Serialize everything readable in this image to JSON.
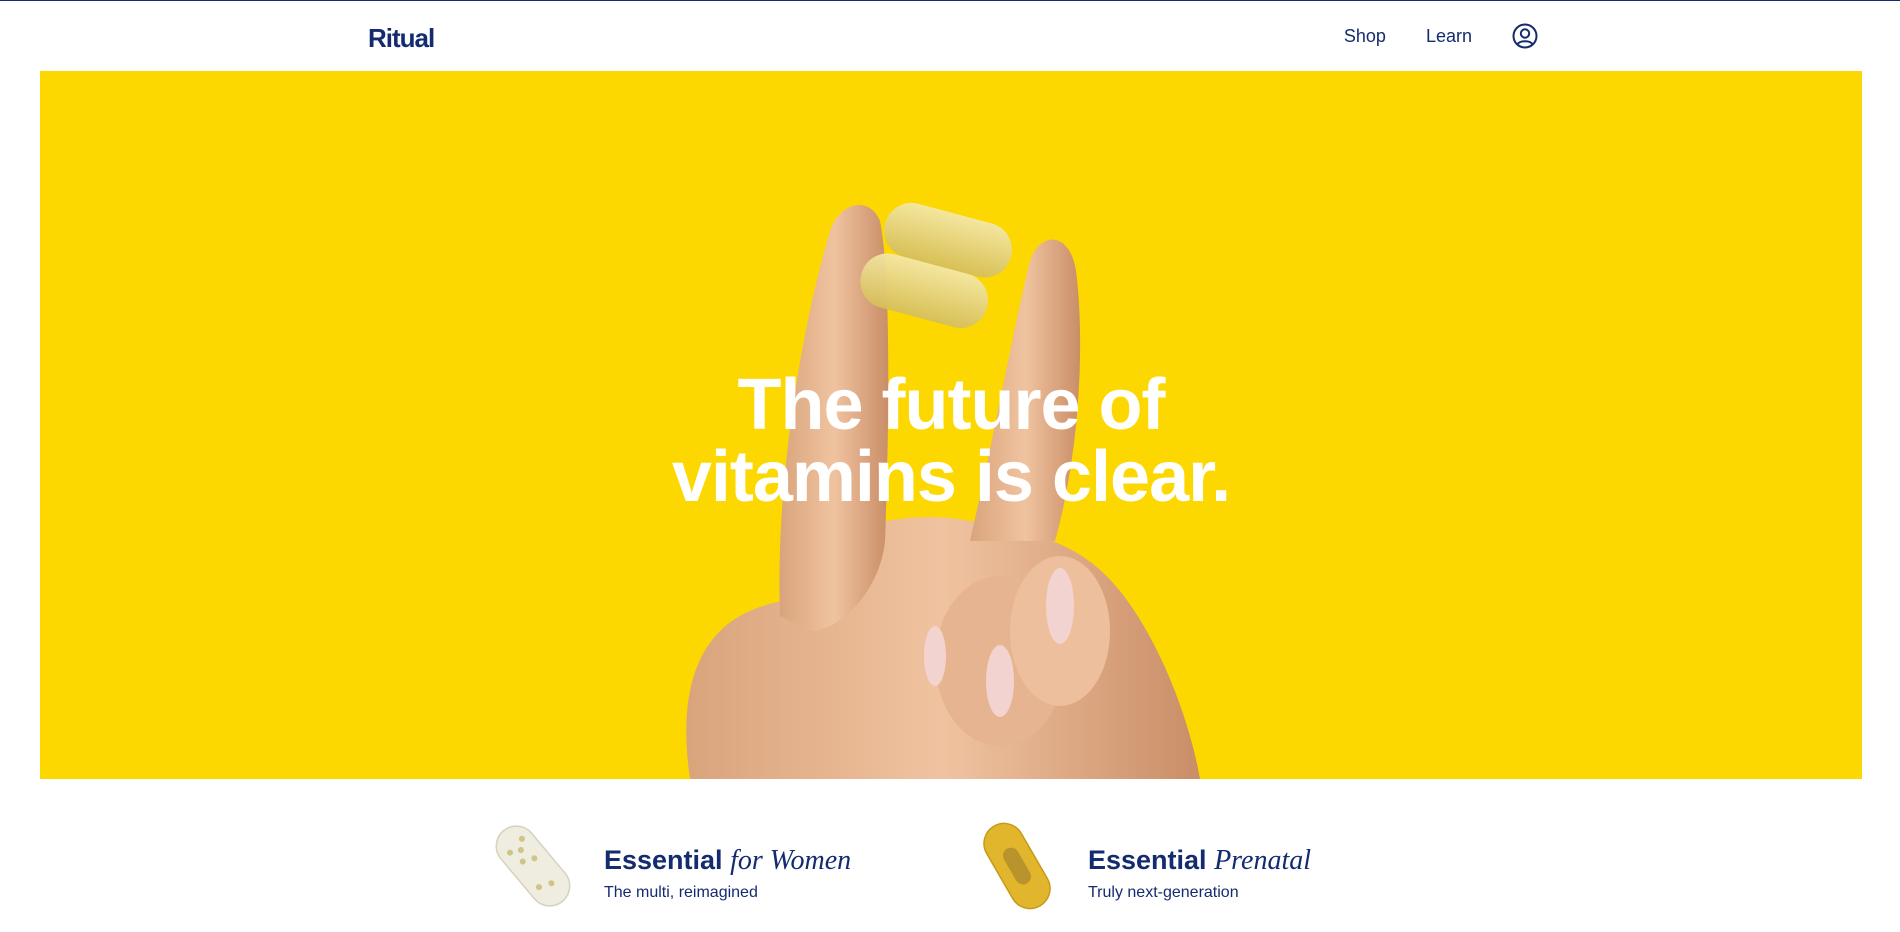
{
  "header": {
    "logo": "Ritual",
    "nav": {
      "shop_label": "Shop",
      "learn_label": "Learn"
    },
    "account_icon": "user-circle-icon"
  },
  "hero": {
    "background_color": "#fdd800",
    "headline_line1": "The future of",
    "headline_line2": "vitamins is clear."
  },
  "products": [
    {
      "title_bold": "Essential",
      "title_italic": "for Women",
      "subtitle": "The multi, reimagined",
      "icon": "clear-capsule-icon"
    },
    {
      "title_bold": "Essential",
      "title_italic": "Prenatal",
      "subtitle": "Truly next-generation",
      "icon": "gold-capsule-icon"
    }
  ],
  "colors": {
    "brand_navy": "#142b6f",
    "hero_yellow": "#fdd800",
    "headline_white": "#ffffff"
  }
}
